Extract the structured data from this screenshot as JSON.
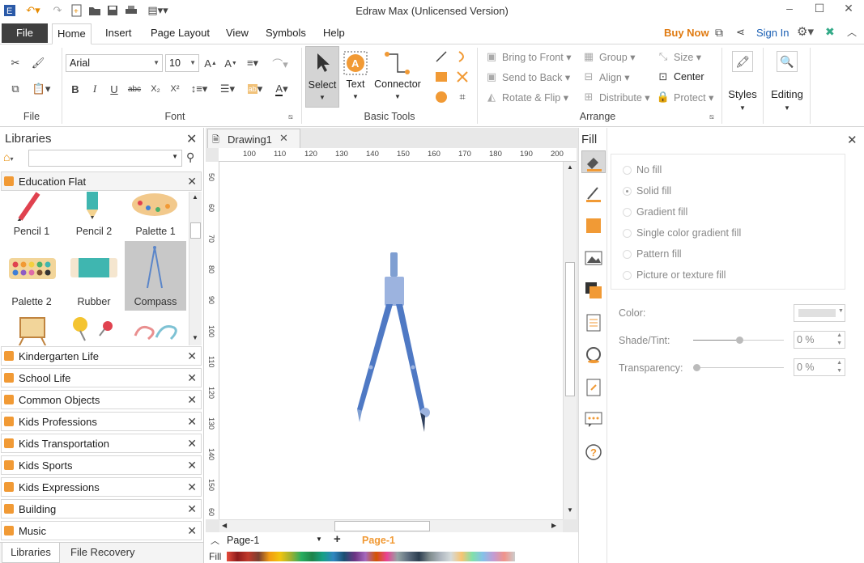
{
  "app": {
    "title": "Edraw Max (Unlicensed Version)"
  },
  "menu": {
    "file": "File",
    "tabs": [
      "Home",
      "Insert",
      "Page Layout",
      "View",
      "Symbols",
      "Help"
    ],
    "buy_now": "Buy Now",
    "sign_in": "Sign In"
  },
  "ribbon": {
    "file_group": "File",
    "font_group": "Font",
    "font_name": "Arial",
    "font_size": "10",
    "basic_tools_group": "Basic Tools",
    "select": "Select",
    "text": "Text",
    "connector": "Connector",
    "arrange_group": "Arrange",
    "bring_to_front": "Bring to Front",
    "send_to_back": "Send to Back",
    "rotate_flip": "Rotate & Flip",
    "group": "Group",
    "align": "Align",
    "distribute": "Distribute",
    "size": "Size",
    "center": "Center",
    "protect": "Protect",
    "styles": "Styles",
    "editing": "Editing"
  },
  "libraries": {
    "title": "Libraries",
    "open_library": "Education Flat",
    "shapes": [
      "Pencil 1",
      "Pencil 2",
      "Palette 1",
      "Palette 2",
      "Rubber",
      "Compass"
    ],
    "other_libraries": [
      "Kindergarten Life",
      "School Life",
      "Common Objects",
      "Kids Professions",
      "Kids Transportation",
      "Kids Sports",
      "Kids Expressions",
      "Building",
      "Music"
    ],
    "bottom_tabs": [
      "Libraries",
      "File Recovery"
    ]
  },
  "document": {
    "tab": "Drawing1",
    "ruler_h": [
      "100",
      "110",
      "120",
      "130",
      "140",
      "150",
      "160",
      "170",
      "180",
      "190",
      "200"
    ],
    "ruler_v": [
      "50",
      "60",
      "70",
      "80",
      "90",
      "100",
      "110",
      "120",
      "130",
      "140",
      "150",
      "60"
    ],
    "page_select": "Page-1",
    "page_tab": "Page-1",
    "fill_label": "Fill"
  },
  "fill_panel": {
    "title": "Fill",
    "options": [
      "No fill",
      "Solid fill",
      "Gradient fill",
      "Single color gradient fill",
      "Pattern fill",
      "Picture or texture fill"
    ],
    "color_label": "Color:",
    "shade_label": "Shade/Tint:",
    "shade_value": "0 %",
    "transparency_label": "Transparency:",
    "transparency_value": "0 %"
  },
  "colors": {
    "accent": "#f19a35",
    "dark_tab": "#3f3f3f",
    "link": "#1a5fb4",
    "buy": "#e07a10"
  }
}
